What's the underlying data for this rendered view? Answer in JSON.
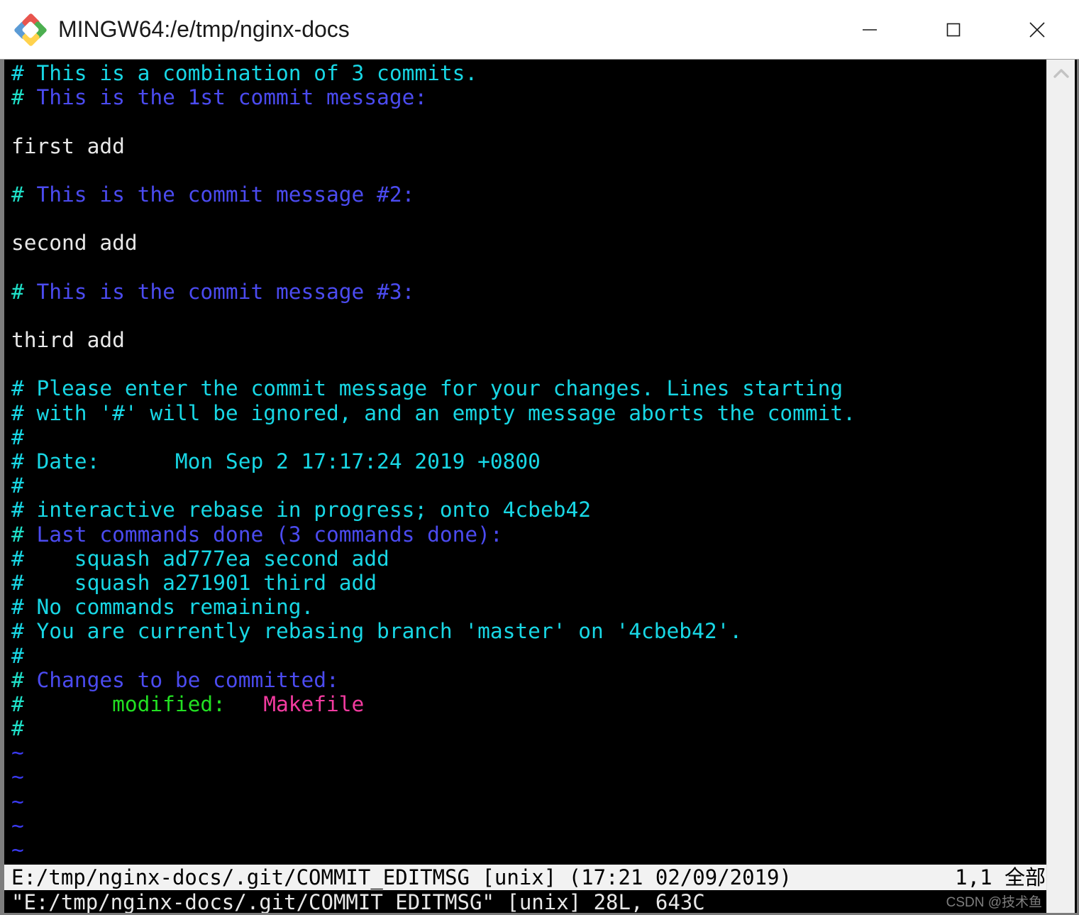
{
  "window": {
    "title": "MINGW64:/e/tmp/nginx-docs",
    "app_icon": "mingw-diamond-icon",
    "controls": {
      "minimize": "minimize-icon",
      "maximize": "maximize-icon",
      "close": "close-icon"
    }
  },
  "colors": {
    "background": "#000000",
    "comment_cyan": "#18d7e5",
    "hash_cyan": "#1fe0c8",
    "comment_blue": "#4b4bf0",
    "text_white": "#e8e8e8",
    "modified_green": "#22e022",
    "filename_magenta": "#f33ba0",
    "tilde_blue": "#3b3bf5",
    "statusline_bg": "#f2f2f2",
    "statusline_fg": "#000000",
    "titlebar_bg": "#ffffff"
  },
  "editor": {
    "lines": [
      {
        "segments": [
          {
            "text": "# This is a combination of 3 commits.",
            "color": "c-cyan"
          }
        ]
      },
      {
        "segments": [
          {
            "text": "#",
            "color": "c-hash"
          },
          {
            "text": " This is the 1st commit message:",
            "color": "c-blue"
          }
        ]
      },
      {
        "segments": [
          {
            "text": "",
            "color": "c-white"
          }
        ]
      },
      {
        "segments": [
          {
            "text": "first add",
            "color": "c-white"
          }
        ]
      },
      {
        "segments": [
          {
            "text": "",
            "color": "c-white"
          }
        ]
      },
      {
        "segments": [
          {
            "text": "#",
            "color": "c-hash"
          },
          {
            "text": " This is the commit message #2:",
            "color": "c-blue"
          }
        ]
      },
      {
        "segments": [
          {
            "text": "",
            "color": "c-white"
          }
        ]
      },
      {
        "segments": [
          {
            "text": "second add",
            "color": "c-white"
          }
        ]
      },
      {
        "segments": [
          {
            "text": "",
            "color": "c-white"
          }
        ]
      },
      {
        "segments": [
          {
            "text": "#",
            "color": "c-hash"
          },
          {
            "text": " This is the commit message #3:",
            "color": "c-blue"
          }
        ]
      },
      {
        "segments": [
          {
            "text": "",
            "color": "c-white"
          }
        ]
      },
      {
        "segments": [
          {
            "text": "third add",
            "color": "c-white"
          }
        ]
      },
      {
        "segments": [
          {
            "text": "",
            "color": "c-white"
          }
        ]
      },
      {
        "segments": [
          {
            "text": "# Please enter the commit message for your changes. Lines starting",
            "color": "c-cyan"
          }
        ]
      },
      {
        "segments": [
          {
            "text": "# with '#' will be ignored, and an empty message aborts the commit.",
            "color": "c-cyan"
          }
        ]
      },
      {
        "segments": [
          {
            "text": "#",
            "color": "c-cyan"
          }
        ]
      },
      {
        "segments": [
          {
            "text": "# Date:      Mon Sep 2 17:17:24 2019 +0800",
            "color": "c-cyan"
          }
        ]
      },
      {
        "segments": [
          {
            "text": "#",
            "color": "c-cyan"
          }
        ]
      },
      {
        "segments": [
          {
            "text": "# interactive rebase in progress; onto 4cbeb42",
            "color": "c-cyan"
          }
        ]
      },
      {
        "segments": [
          {
            "text": "#",
            "color": "c-hash"
          },
          {
            "text": " Last commands done (3 commands done):",
            "color": "c-blue"
          }
        ]
      },
      {
        "segments": [
          {
            "text": "#    squash ad777ea second add",
            "color": "c-cyan"
          }
        ]
      },
      {
        "segments": [
          {
            "text": "#    squash a271901 third add",
            "color": "c-cyan"
          }
        ]
      },
      {
        "segments": [
          {
            "text": "# No commands remaining.",
            "color": "c-cyan"
          }
        ]
      },
      {
        "segments": [
          {
            "text": "# You are currently rebasing branch 'master' on '4cbeb42'.",
            "color": "c-cyan"
          }
        ]
      },
      {
        "segments": [
          {
            "text": "#",
            "color": "c-cyan"
          }
        ]
      },
      {
        "segments": [
          {
            "text": "#",
            "color": "c-hash"
          },
          {
            "text": " Changes to be committed:",
            "color": "c-blue"
          }
        ]
      },
      {
        "segments": [
          {
            "text": "#",
            "color": "c-hash"
          },
          {
            "text": "       modified:   ",
            "color": "c-green"
          },
          {
            "text": "Makefile",
            "color": "c-mag"
          }
        ]
      },
      {
        "segments": [
          {
            "text": "#",
            "color": "c-hash"
          }
        ]
      },
      {
        "segments": [
          {
            "text": "~",
            "color": "c-tilde"
          }
        ]
      },
      {
        "segments": [
          {
            "text": "~",
            "color": "c-tilde"
          }
        ]
      },
      {
        "segments": [
          {
            "text": "~",
            "color": "c-tilde"
          }
        ]
      },
      {
        "segments": [
          {
            "text": "~",
            "color": "c-tilde"
          }
        ]
      },
      {
        "segments": [
          {
            "text": "~",
            "color": "c-tilde"
          }
        ]
      }
    ]
  },
  "statusline": {
    "left": "E:/tmp/nginx-docs/.git/COMMIT_EDITMSG [unix] (17:21 02/09/2019)",
    "right": "1,1 全部"
  },
  "cmdline": {
    "text": "\"E:/tmp/nginx-docs/.git/COMMIT_EDITMSG\" [unix] 28L, 643C"
  },
  "scrollbar": {
    "up_arrow": "chevron-up-icon"
  },
  "watermark": {
    "text": "CSDN @技术鱼"
  }
}
